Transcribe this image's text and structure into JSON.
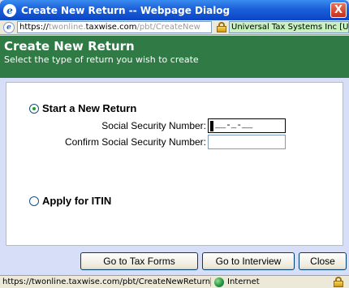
{
  "window": {
    "title": "Create New Return -- Webpage Dialog",
    "close_glyph": "X"
  },
  "address": {
    "scheme": "https://",
    "pre": "twonline.",
    "domain": "taxwise.com",
    "path": "/pbt/CreateNew",
    "certificate": "Universal Tax Systems Inc [US]"
  },
  "header": {
    "title": "Create New Return",
    "subtitle": "Select the type of return you wish to create"
  },
  "form": {
    "option_new": "Start a New Return",
    "ssn_label": "Social Security Number:",
    "ssn_value": "__-_-__",
    "confirm_ssn_label": "Confirm Social Security Number:",
    "confirm_ssn_value": "",
    "option_itin": "Apply for ITIN"
  },
  "buttons": {
    "tax_forms": "Go to Tax Forms",
    "interview": "Go to Interview",
    "close": "Close"
  },
  "status": {
    "url": "https://twonline.taxwise.com/pbt/CreateNewReturn.",
    "zone": "Internet"
  },
  "colors": {
    "header_bg": "#2f7a45",
    "titlebar": "#0a46c6",
    "radio_dot": "#21a121"
  }
}
